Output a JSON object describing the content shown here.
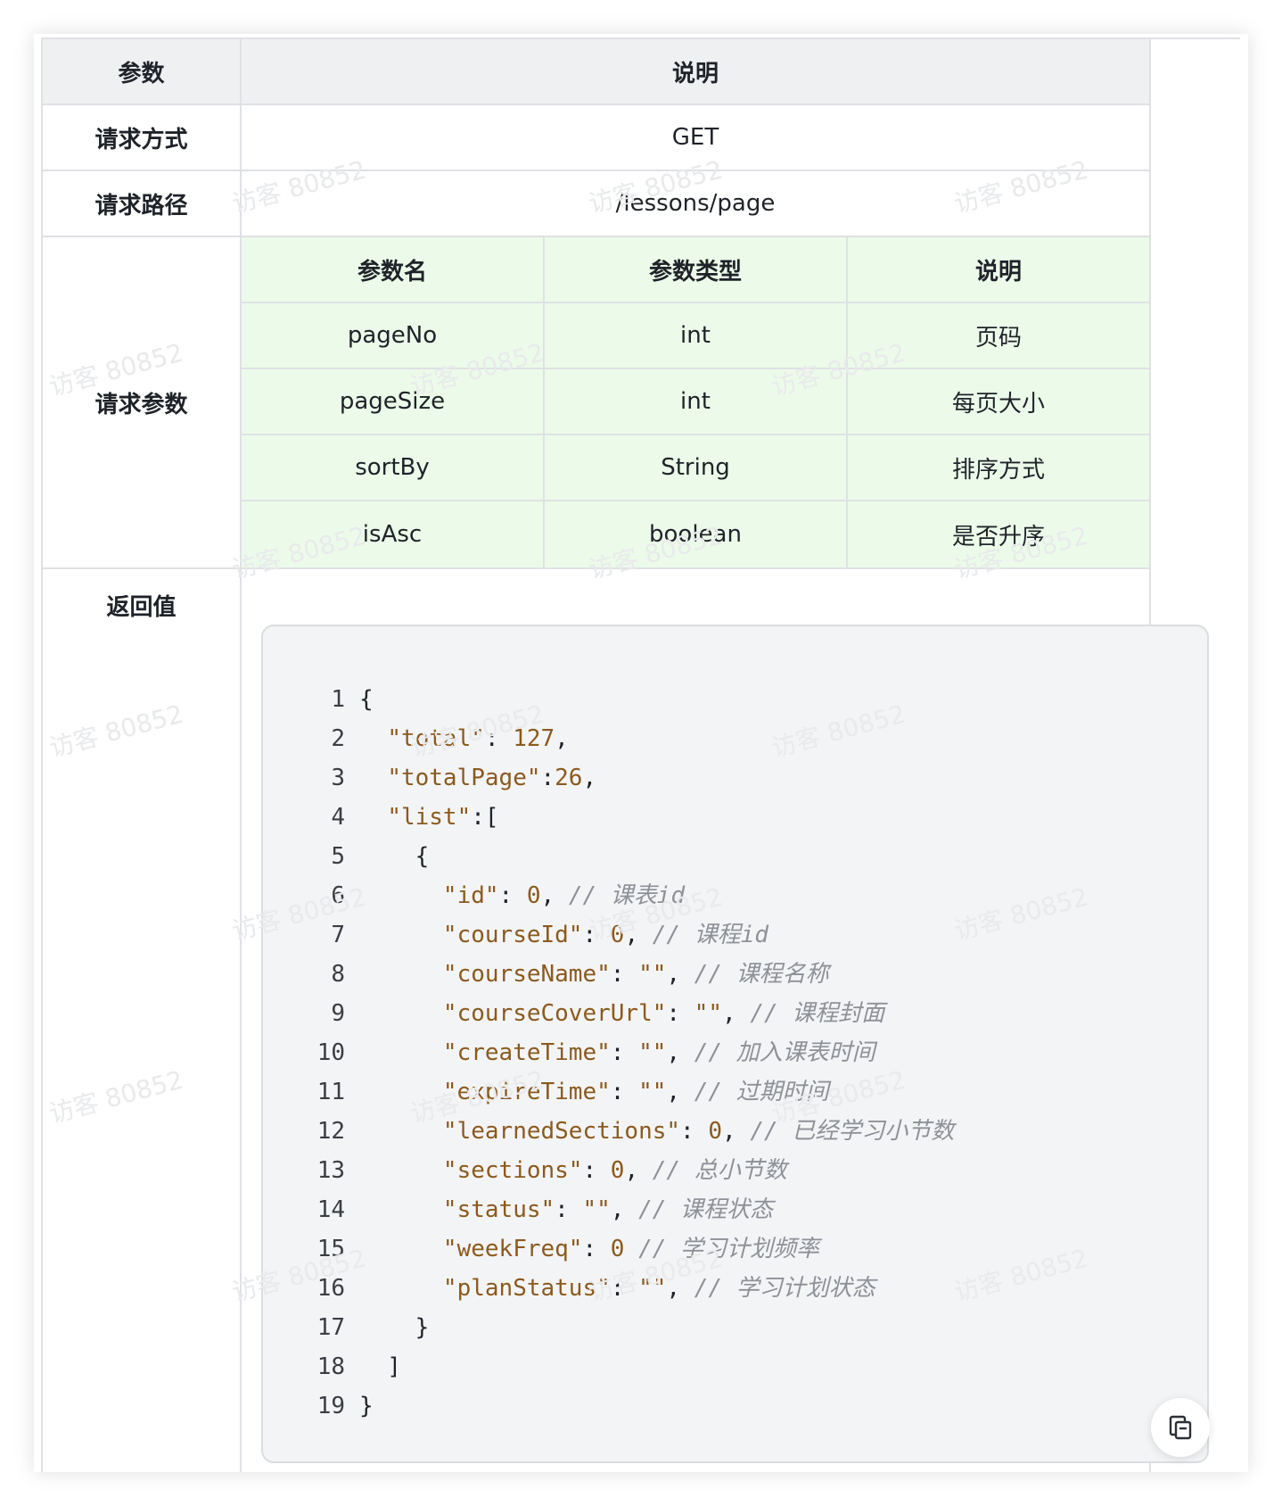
{
  "table": {
    "header": {
      "param": "参数",
      "desc": "说明"
    },
    "method": {
      "label": "请求方式",
      "value": "GET"
    },
    "path": {
      "label": "请求路径",
      "value": "/lessons/page"
    },
    "params": {
      "label": "请求参数",
      "columns": [
        "参数名",
        "参数类型",
        "说明"
      ],
      "rows": [
        {
          "name": "pageNo",
          "type": "int",
          "desc": "页码"
        },
        {
          "name": "pageSize",
          "type": "int",
          "desc": "每页大小"
        },
        {
          "name": "sortBy",
          "type": "String",
          "desc": "排序方式"
        },
        {
          "name": "isAsc",
          "type": "boolean",
          "desc": "是否升序"
        }
      ]
    },
    "response": {
      "label": "返回值"
    }
  },
  "code": {
    "lines": [
      {
        "no": "1",
        "parts": [
          [
            "p",
            "{"
          ]
        ]
      },
      {
        "no": "2",
        "parts": [
          [
            "p",
            "  "
          ],
          [
            "k",
            "\"total\""
          ],
          [
            "p",
            ": "
          ],
          [
            "n",
            "127"
          ],
          [
            "p",
            ","
          ]
        ]
      },
      {
        "no": "3",
        "parts": [
          [
            "p",
            "  "
          ],
          [
            "k",
            "\"totalPage\""
          ],
          [
            "p",
            ":"
          ],
          [
            "n",
            "26"
          ],
          [
            "p",
            ","
          ]
        ]
      },
      {
        "no": "4",
        "parts": [
          [
            "p",
            "  "
          ],
          [
            "k",
            "\"list\""
          ],
          [
            "p",
            ":["
          ]
        ]
      },
      {
        "no": "5",
        "parts": [
          [
            "p",
            "    {"
          ]
        ]
      },
      {
        "no": "6",
        "parts": [
          [
            "p",
            "      "
          ],
          [
            "k",
            "\"id\""
          ],
          [
            "p",
            ": "
          ],
          [
            "n",
            "0"
          ],
          [
            "p",
            ", "
          ],
          [
            "c",
            "// 课表id"
          ]
        ]
      },
      {
        "no": "7",
        "parts": [
          [
            "p",
            "      "
          ],
          [
            "k",
            "\"courseId\""
          ],
          [
            "p",
            ": "
          ],
          [
            "n",
            "0"
          ],
          [
            "p",
            ", "
          ],
          [
            "c",
            "// 课程id"
          ]
        ]
      },
      {
        "no": "8",
        "parts": [
          [
            "p",
            "      "
          ],
          [
            "k",
            "\"courseName\""
          ],
          [
            "p",
            ": "
          ],
          [
            "k",
            "\"\""
          ],
          [
            "p",
            ", "
          ],
          [
            "c",
            "// 课程名称"
          ]
        ]
      },
      {
        "no": "9",
        "parts": [
          [
            "p",
            "      "
          ],
          [
            "k",
            "\"courseCoverUrl\""
          ],
          [
            "p",
            ": "
          ],
          [
            "k",
            "\"\""
          ],
          [
            "p",
            ", "
          ],
          [
            "c",
            "// 课程封面"
          ]
        ]
      },
      {
        "no": "10",
        "parts": [
          [
            "p",
            "      "
          ],
          [
            "k",
            "\"createTime\""
          ],
          [
            "p",
            ": "
          ],
          [
            "k",
            "\"\""
          ],
          [
            "p",
            ", "
          ],
          [
            "c",
            "// 加入课表时间"
          ]
        ]
      },
      {
        "no": "11",
        "parts": [
          [
            "p",
            "      "
          ],
          [
            "k",
            "\"expireTime\""
          ],
          [
            "p",
            ": "
          ],
          [
            "k",
            "\"\""
          ],
          [
            "p",
            ", "
          ],
          [
            "c",
            "// 过期时间"
          ]
        ]
      },
      {
        "no": "12",
        "parts": [
          [
            "p",
            "      "
          ],
          [
            "k",
            "\"learnedSections\""
          ],
          [
            "p",
            ": "
          ],
          [
            "n",
            "0"
          ],
          [
            "p",
            ", "
          ],
          [
            "c",
            "// 已经学习小节数"
          ]
        ]
      },
      {
        "no": "13",
        "parts": [
          [
            "p",
            "      "
          ],
          [
            "k",
            "\"sections\""
          ],
          [
            "p",
            ": "
          ],
          [
            "n",
            "0"
          ],
          [
            "p",
            ", "
          ],
          [
            "c",
            "// 总小节数"
          ]
        ]
      },
      {
        "no": "14",
        "parts": [
          [
            "p",
            "      "
          ],
          [
            "k",
            "\"status\""
          ],
          [
            "p",
            ": "
          ],
          [
            "k",
            "\"\""
          ],
          [
            "p",
            ", "
          ],
          [
            "c",
            "// 课程状态"
          ]
        ]
      },
      {
        "no": "15",
        "parts": [
          [
            "p",
            "      "
          ],
          [
            "k",
            "\"weekFreq\""
          ],
          [
            "p",
            ": "
          ],
          [
            "n",
            "0"
          ],
          [
            "p",
            " "
          ],
          [
            "c",
            "// 学习计划频率"
          ]
        ]
      },
      {
        "no": "16",
        "parts": [
          [
            "p",
            "      "
          ],
          [
            "k",
            "\"planStatus\""
          ],
          [
            "p",
            ": "
          ],
          [
            "k",
            "\"\""
          ],
          [
            "p",
            ", "
          ],
          [
            "c",
            "// 学习计划状态"
          ]
        ]
      },
      {
        "no": "17",
        "parts": [
          [
            "p",
            "    }"
          ]
        ]
      },
      {
        "no": "18",
        "parts": [
          [
            "p",
            "  ]"
          ]
        ]
      },
      {
        "no": "19",
        "parts": [
          [
            "p",
            "}"
          ]
        ]
      }
    ]
  },
  "copy_button": {
    "icon": "copy-icon"
  },
  "watermark": "访客 80852",
  "colors": {
    "header_bg": "#eff0f1",
    "param_table_bg": "#ecfbe9",
    "code_bg": "#f3f4f6",
    "code_key": "#8b5a1e",
    "code_comment": "#8e9197"
  }
}
